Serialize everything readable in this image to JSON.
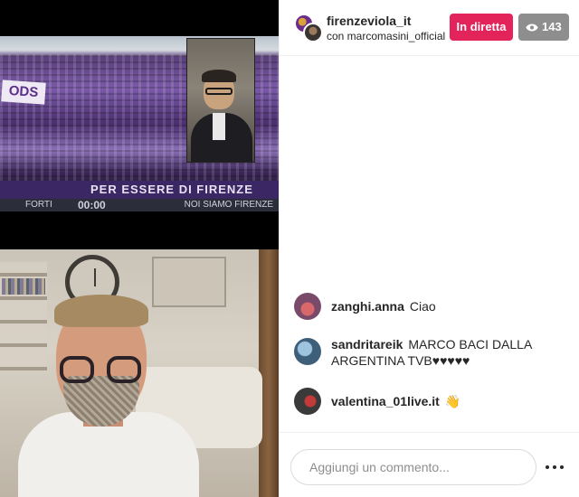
{
  "header": {
    "account_name": "firenzeviola_it",
    "with_text": "con marcomasini_official",
    "live_label": "In diretta",
    "viewer_count": "143",
    "live_color": "#e3245a"
  },
  "video": {
    "banner_left": "ODS",
    "stadium_banner": "PER ESSERE DI FIRENZE",
    "scoreboard_left": "FORTI",
    "scoreboard_time": "00:00",
    "scoreboard_right": "NOI SIAMO FIRENZE"
  },
  "comments": [
    {
      "user": "zanghi.anna",
      "text": "Ciao"
    },
    {
      "user": "sandritareik",
      "text": "MARCO BACI DALLA ARGENTINA TVB♥♥♥♥♥"
    },
    {
      "user": "valentina_01live.it",
      "text": "👋"
    }
  ],
  "footer": {
    "comment_placeholder": "Aggiungi un commento...",
    "more_icon": "more-horizontal-icon"
  }
}
